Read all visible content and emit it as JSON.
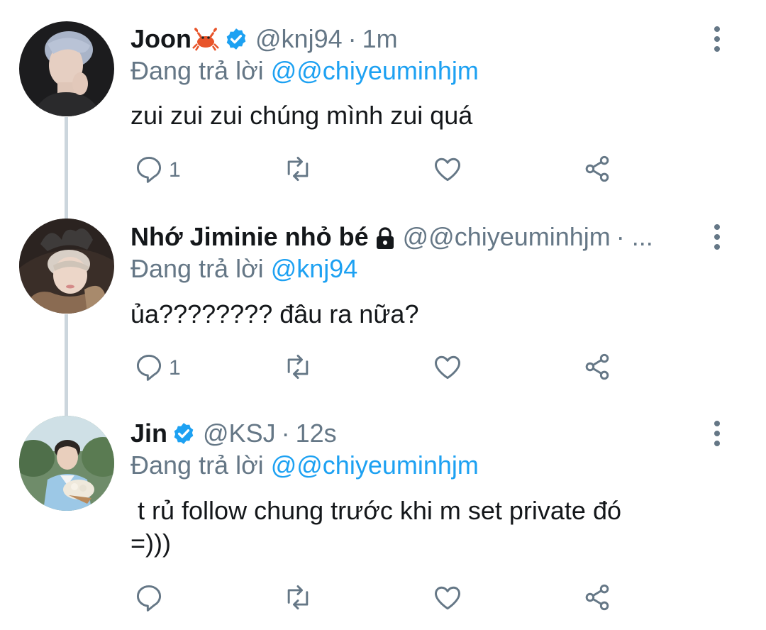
{
  "colors": {
    "name": "#14171a",
    "secondary": "#657786",
    "mention": "#1da1f2",
    "verified": "#1da1f2",
    "thread_line": "#ccd6dd",
    "background": "#ffffff"
  },
  "tweets": [
    {
      "author": "Joon",
      "emoji": "crab-icon",
      "verified": true,
      "handle": "@knj94",
      "separator": "·",
      "time": "1m",
      "replying_label": "Đang trả lời",
      "replying_to": "@@chiyeuminhjm",
      "text": "zui zui zui chúng mình zui quá",
      "reply_count": "1",
      "icons": [
        "reply-icon",
        "retweet-icon",
        "like-icon",
        "share-icon",
        "more-options-icon"
      ]
    },
    {
      "author": "Nhớ Jiminie nhỏ bé",
      "locked": true,
      "handle": "@@chiyeuminhjm",
      "separator": "·",
      "truncation": "...",
      "replying_label": "Đang trả lời",
      "replying_to": "@knj94",
      "text": "ủa???????? đâu ra nữa?",
      "reply_count": "1",
      "icons": [
        "reply-icon",
        "retweet-icon",
        "like-icon",
        "share-icon",
        "more-options-icon"
      ]
    },
    {
      "author": "Jin",
      "verified": true,
      "handle": "@KSJ",
      "separator": "·",
      "time": "12s",
      "replying_label": "Đang trả lời",
      "replying_to": "@@chiyeuminhjm",
      "text": " t rủ follow chung trước khi m set private đó\n=)))",
      "reply_count": "",
      "icons": [
        "reply-icon",
        "retweet-icon",
        "like-icon",
        "share-icon",
        "more-options-icon"
      ]
    }
  ]
}
